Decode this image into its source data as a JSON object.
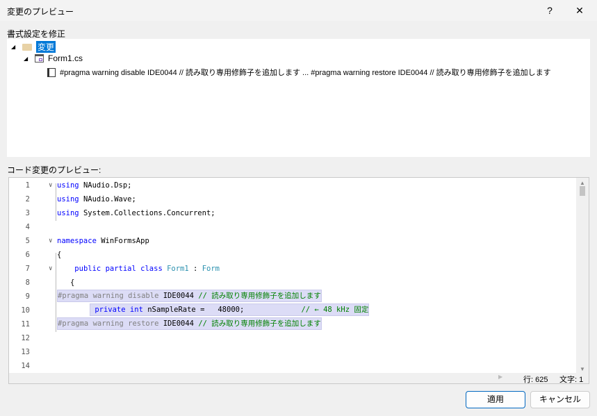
{
  "window": {
    "title": "変更のプレビュー",
    "help": "?",
    "close": "✕"
  },
  "tree": {
    "label": "書式設定を修正",
    "root": "変更",
    "file": "Form1.cs",
    "change": "#pragma warning disable IDE0044 // 読み取り専用修飾子を追加します ... #pragma warning restore IDE0044 // 読み取り専用修飾子を追加します"
  },
  "preview": {
    "label": "コード変更のプレビュー:",
    "lines": [
      {
        "n": "1",
        "tokens": [
          [
            "kw",
            "using"
          ],
          [
            "",
            "NAudio.Dsp;"
          ]
        ]
      },
      {
        "n": "2",
        "tokens": [
          [
            "kw",
            "using"
          ],
          [
            "",
            "NAudio.Wave;"
          ]
        ]
      },
      {
        "n": "3",
        "tokens": [
          [
            "kw",
            "using"
          ],
          [
            "",
            "System.Collections.Concurrent;"
          ]
        ]
      },
      {
        "n": "4",
        "tokens": []
      },
      {
        "n": "5",
        "tokens": [
          [
            "kw",
            "namespace"
          ],
          [
            "",
            "WinFormsApp"
          ]
        ]
      },
      {
        "n": "6",
        "tokens": [
          [
            "",
            "{"
          ]
        ]
      },
      {
        "n": "7",
        "tokens": [
          [
            "",
            "   "
          ],
          [
            "kw",
            "public"
          ],
          [
            "kw",
            "partial"
          ],
          [
            "kw",
            "class"
          ],
          [
            "ty",
            "Form1"
          ],
          [
            "",
            ":"
          ],
          [
            "ty",
            "Form"
          ]
        ]
      },
      {
        "n": "8",
        "tokens": [
          [
            "",
            "   {"
          ]
        ]
      },
      {
        "n": "9",
        "tokens": [
          [
            "pp",
            "#pragma warning disable"
          ],
          [
            "",
            "IDE0044"
          ],
          [
            "cm",
            "// 読み取り専用修飾子を追加します"
          ]
        ]
      },
      {
        "n": "10",
        "tokens": [
          [
            "",
            "       "
          ],
          [
            "kw",
            "private"
          ],
          [
            "kw",
            "int"
          ],
          [
            "",
            "nSampleRate =   48000;            "
          ],
          [
            "cm",
            "// ← 48 kHz 固定"
          ]
        ]
      },
      {
        "n": "11",
        "tokens": [
          [
            "pp",
            "#pragma warning restore"
          ],
          [
            "",
            "IDE0044"
          ],
          [
            "cm",
            "// 読み取り専用修飾子を追加します"
          ]
        ]
      },
      {
        "n": "12",
        "tokens": []
      },
      {
        "n": "13",
        "tokens": []
      },
      {
        "n": "14",
        "tokens": []
      }
    ]
  },
  "status": {
    "line": "行: 625",
    "col": "文字: 1"
  },
  "buttons": {
    "apply": "適用",
    "cancel": "キャンセル"
  }
}
